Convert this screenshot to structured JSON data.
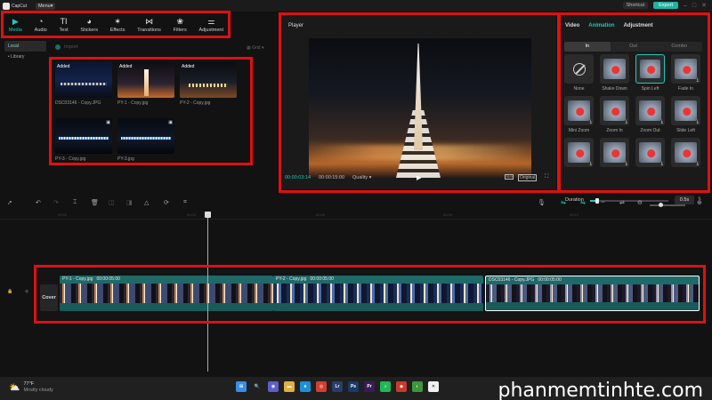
{
  "titlebar": {
    "app_name": "CapCut",
    "menu_label": "Menu",
    "project_name": "",
    "window_title": "",
    "shortcut_label": "Shortcut",
    "export_label": "Export"
  },
  "toolbar": {
    "tools": [
      {
        "label": "Media",
        "icon": "media-icon",
        "glyph": "▶",
        "active": true
      },
      {
        "label": "Audio",
        "icon": "audio-icon",
        "glyph": "◔"
      },
      {
        "label": "Text",
        "icon": "text-icon",
        "glyph": "TI"
      },
      {
        "label": "Stickers",
        "icon": "sticker-icon",
        "glyph": "◕"
      },
      {
        "label": "Effects",
        "icon": "effects-icon",
        "glyph": "✶"
      },
      {
        "label": "Transitions",
        "icon": "transitions-icon",
        "glyph": "⋈"
      },
      {
        "label": "Filters",
        "icon": "filters-icon",
        "glyph": "❀"
      },
      {
        "label": "Adjustment",
        "icon": "adjustment-icon",
        "glyph": "⚌"
      }
    ]
  },
  "media": {
    "sidebar": [
      {
        "label": "Local",
        "active": true
      },
      {
        "label": "• Library"
      }
    ],
    "import_label": "Import",
    "view_label": "Grid",
    "items": [
      {
        "name": "DSC03146 - Copy.JPG",
        "added": "Added",
        "style": "city"
      },
      {
        "name": "PY-1 - Copy.jpg",
        "added": "Added",
        "style": "tower"
      },
      {
        "name": "PY-2 - Copy.jpg",
        "added": "Added",
        "style": "tower2"
      },
      {
        "name": "PY-3 - Copy.jpg",
        "added": "",
        "style": "bridge"
      },
      {
        "name": "PY-3.jpg",
        "added": "",
        "style": "bridge"
      }
    ]
  },
  "player": {
    "title": "Player",
    "current_time": "00:00:03:14",
    "total_time": "00:00:15:00",
    "quality_label": "Quality",
    "ratio_label": "16:9",
    "original_label": "Original"
  },
  "right_panel": {
    "tabs": [
      {
        "label": "Video"
      },
      {
        "label": "Animation",
        "active": true
      },
      {
        "label": "Adjustment"
      }
    ],
    "subtabs": [
      {
        "label": "In",
        "active": true
      },
      {
        "label": "Out"
      },
      {
        "label": "Combo"
      }
    ],
    "animations": [
      {
        "label": "None",
        "type": "none"
      },
      {
        "label": "Shake Down"
      },
      {
        "label": "Spin Left",
        "selected": true
      },
      {
        "label": "Fade In",
        "download": true
      },
      {
        "label": "Mini Zoom",
        "download": true
      },
      {
        "label": "Zoom In",
        "download": true
      },
      {
        "label": "Zoom Out",
        "download": true
      },
      {
        "label": "Slide Left",
        "download": true
      },
      {
        "label": "",
        "download": true
      },
      {
        "label": "",
        "download": true
      },
      {
        "label": "",
        "download": true
      },
      {
        "label": "",
        "download": true
      }
    ],
    "duration_label": "Duration",
    "duration_value": "0.5s"
  },
  "timeline": {
    "ruler": [
      "00:00",
      "00:03",
      "00:06",
      "00:09",
      "00:12"
    ],
    "cover_label": "Cover",
    "clips": [
      {
        "name": "PY-1 - Copy.jpg",
        "duration": "00:00:05:00",
        "frames": "tower"
      },
      {
        "name": "PY-2 - Copy.jpg",
        "duration": "00:00:05:00",
        "frames": "city"
      },
      {
        "name": "DSC03146 - Copy.JPG",
        "duration": "00:00:05:00",
        "frames": "bridge",
        "selected": true
      }
    ]
  },
  "taskbar": {
    "temperature": "77°F",
    "weather": "Mostly cloudy",
    "apps": [
      {
        "name": "windows-start",
        "color": "#3a8ee6",
        "glyph": "⊞"
      },
      {
        "name": "search",
        "color": "#202020",
        "glyph": "🔍"
      },
      {
        "name": "chat",
        "color": "#5b5fc7",
        "glyph": "◉"
      },
      {
        "name": "explorer",
        "color": "#e0b040",
        "glyph": "▬"
      },
      {
        "name": "edge",
        "color": "#1f8fd8",
        "glyph": "e"
      },
      {
        "name": "chrome",
        "color": "#d04030",
        "glyph": "◎"
      },
      {
        "name": "lightroom",
        "color": "#2b3b6a",
        "glyph": "Lr"
      },
      {
        "name": "photoshop",
        "color": "#1b3a6a",
        "glyph": "Ps"
      },
      {
        "name": "premiere",
        "color": "#3a1a5a",
        "glyph": "Pr"
      },
      {
        "name": "spotify",
        "color": "#1db954",
        "glyph": "♫"
      },
      {
        "name": "app-red",
        "color": "#c83a2a",
        "glyph": "◆"
      },
      {
        "name": "app-green",
        "color": "#3a9a3a",
        "glyph": "◐"
      },
      {
        "name": "capcut",
        "color": "#f0f0f0",
        "glyph": "✕"
      }
    ]
  },
  "watermark": "phanmemtinhte.com",
  "colors": {
    "accent": "#26c7b8",
    "highlight": "#e01010"
  }
}
